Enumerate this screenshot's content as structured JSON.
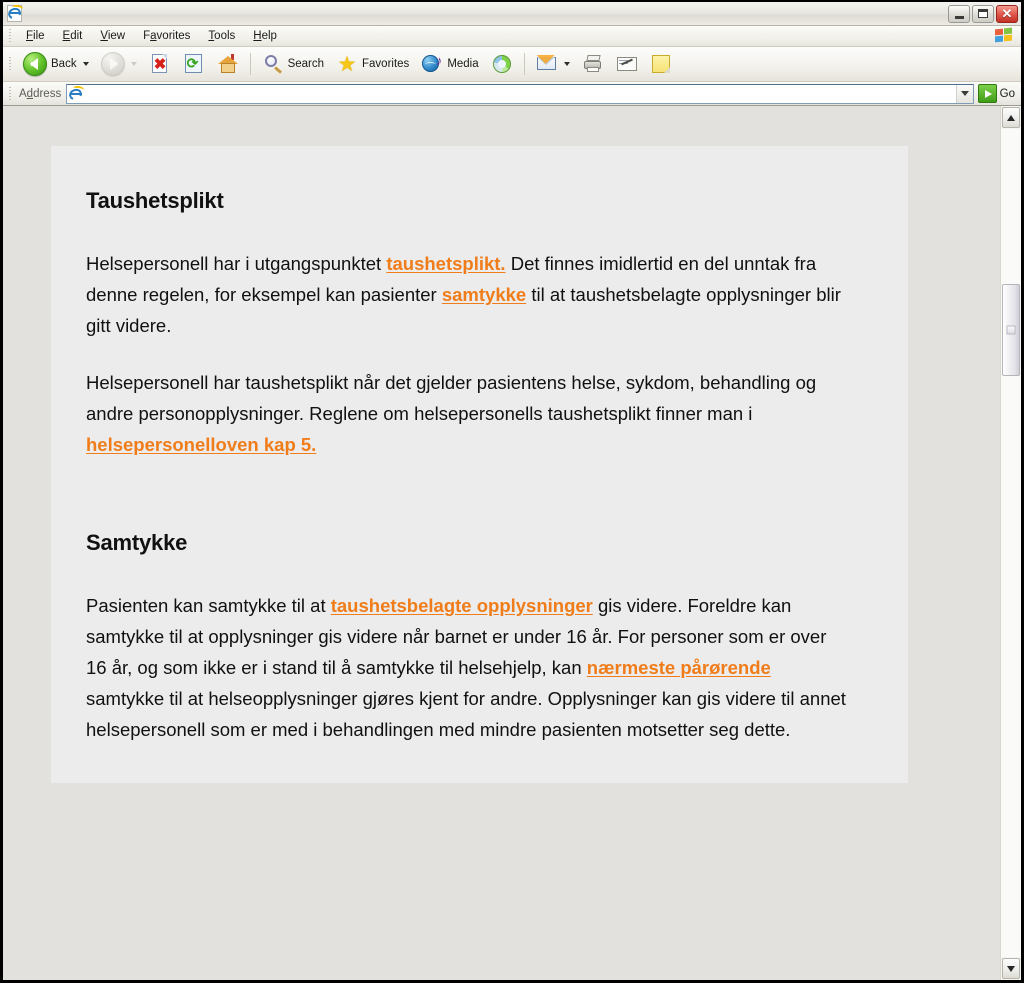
{
  "window": {
    "title": "",
    "controls": {
      "minimize": "Minimize",
      "restore": "Restore",
      "close": "Close",
      "close_glyph": "✕"
    },
    "app_icon": "internet-explorer-icon"
  },
  "menubar": {
    "items": [
      {
        "label": "File",
        "accel": "F"
      },
      {
        "label": "Edit",
        "accel": "E"
      },
      {
        "label": "View",
        "accel": "V"
      },
      {
        "label": "Favorites",
        "accel": "a"
      },
      {
        "label": "Tools",
        "accel": "T"
      },
      {
        "label": "Help",
        "accel": "H"
      }
    ],
    "brand_icon": "windows-flag-icon"
  },
  "toolbar": {
    "back_label": "Back",
    "back_icon": "back-arrow-icon",
    "forward_label": "Forward",
    "forward_icon": "forward-arrow-icon",
    "stop_label": "Stop",
    "stop_icon": "stop-icon",
    "refresh_label": "Refresh",
    "refresh_icon": "refresh-icon",
    "home_label": "Home",
    "home_icon": "home-icon",
    "search_label": "Search",
    "search_icon": "search-icon",
    "favorites_label": "Favorites",
    "favorites_icon": "star-icon",
    "media_label": "Media",
    "media_icon": "media-globe-icon",
    "history_label": "History",
    "history_icon": "history-icon",
    "mail_label": "Mail",
    "mail_icon": "mail-icon",
    "print_label": "Print",
    "print_icon": "printer-icon",
    "edit_label": "Edit",
    "edit_icon": "edit-page-icon",
    "messenger_label": "Messenger",
    "messenger_icon": "yellow-note-icon"
  },
  "addressbar": {
    "label": "Address",
    "value": "",
    "placeholder": "",
    "icon": "internet-explorer-icon",
    "dropdown_icon": "chevron-down-icon",
    "go_label": "Go",
    "go_icon": "go-arrow-icon"
  },
  "scrollbar": {
    "up_icon": "chevron-up-icon",
    "down_icon": "chevron-down-icon",
    "thumb": "scroll-thumb"
  },
  "page": {
    "section1": {
      "heading": "Taushetsplikt",
      "p1": {
        "t1": "Helsepersonell har i utgangspunktet ",
        "link1": "taushetsplikt.",
        "t2": " Det finnes imidlertid en del unntak fra denne regelen, for eksempel kan pasienter ",
        "link2": "samtykke",
        "t3": " til at taushetsbelagte opplysninger blir gitt videre."
      },
      "p2": {
        "t1": "Helsepersonell har taushetsplikt når det gjelder pasientens helse, sykdom, behandling og andre personopplysninger. Reglene om helsepersonells taushetsplikt finner man i ",
        "link1": "helsepersonelloven kap 5."
      }
    },
    "section2": {
      "heading": "Samtykke",
      "p1": {
        "t1": "Pasienten kan samtykke til at ",
        "link1": "taushetsbelagte opplysninger",
        "t2": " gis videre. Foreldre kan samtykke til at opplysninger gis videre når barnet er under 16 år. For personer som er over 16 år, og som ikke er i stand til å samtykke til helsehjelp, kan ",
        "link2": "nærmeste pårørende",
        "t3": " samtykke til at helseopplysninger gjøres kjent for andre. Opplysninger kan gis videre til annet helsepersonell som er med i behandlingen med mindre pasienten motsetter seg dette."
      }
    }
  },
  "colors": {
    "link": "#f07d1a",
    "page_background": "#e3e1dd",
    "card_background": "#ececed",
    "text": "#111111"
  }
}
